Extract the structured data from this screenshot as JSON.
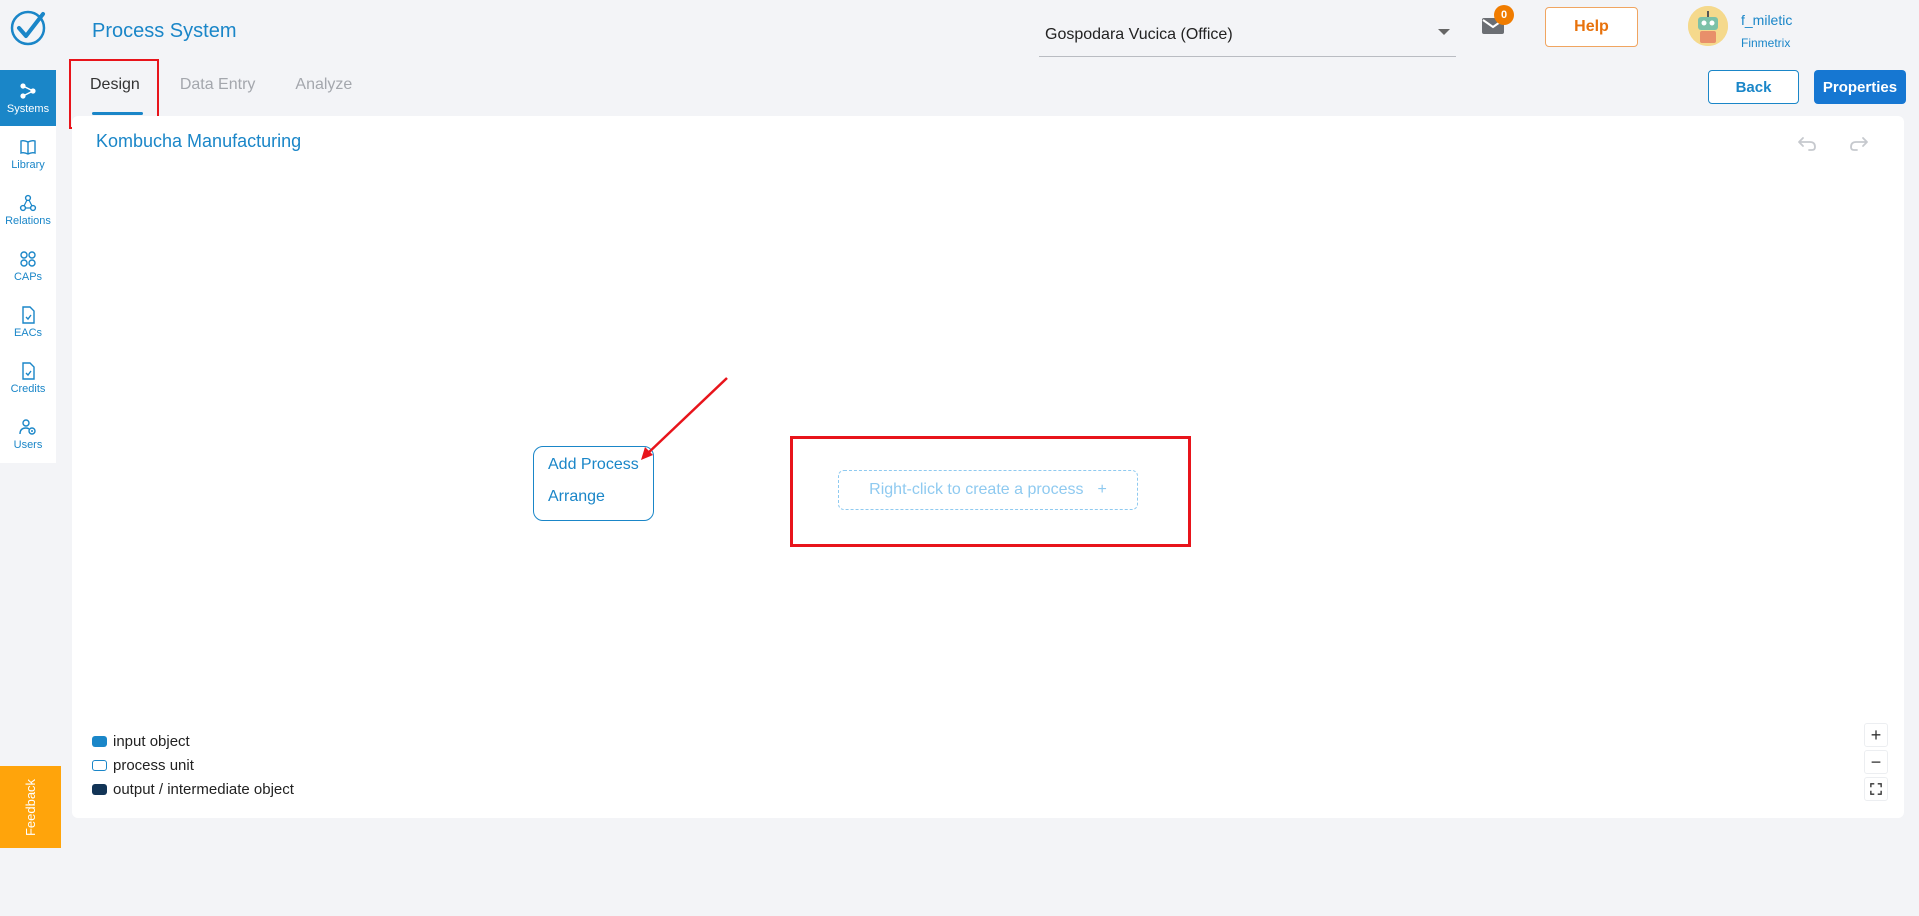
{
  "header": {
    "title": "Process System",
    "organization": "Gospodara Vucica (Office)",
    "mail_count": "0",
    "help_label": "Help",
    "user_name": "f_miletic",
    "user_org": "Finmetrix"
  },
  "sidebar": {
    "items": [
      {
        "label": "Systems",
        "icon": "systems-icon",
        "active": true
      },
      {
        "label": "Library",
        "icon": "book-icon"
      },
      {
        "label": "Relations",
        "icon": "relations-icon"
      },
      {
        "label": "CAPs",
        "icon": "grid-icon"
      },
      {
        "label": "EACs",
        "icon": "document-check-icon"
      },
      {
        "label": "Credits",
        "icon": "document-check-icon"
      },
      {
        "label": "Users",
        "icon": "users-gear-icon"
      }
    ]
  },
  "tabs": [
    {
      "label": "Design",
      "active": true
    },
    {
      "label": "Data Entry"
    },
    {
      "label": "Analyze"
    }
  ],
  "actions": {
    "back_label": "Back",
    "properties_label": "Properties"
  },
  "canvas": {
    "project_title": "Kombucha Manufacturing",
    "context_menu": [
      "Add Process",
      "Arrange"
    ],
    "placeholder": "Right-click to create a process",
    "placeholder_icon": "+"
  },
  "legend": [
    {
      "label": "input object",
      "color": "#1a86c8",
      "style": "filled"
    },
    {
      "label": "process unit",
      "color": "#1a86c8",
      "style": "outline"
    },
    {
      "label": "output / intermediate object",
      "color": "#123456",
      "style": "filled"
    }
  ],
  "zoom": [
    "+",
    "−"
  ],
  "feedback_label": "Feedback",
  "colors": {
    "accent": "#1a86c8",
    "primary_button": "#1677d2",
    "help": "#e8720c",
    "highlight": "#e8141b",
    "feedback": "#ffa40b"
  }
}
